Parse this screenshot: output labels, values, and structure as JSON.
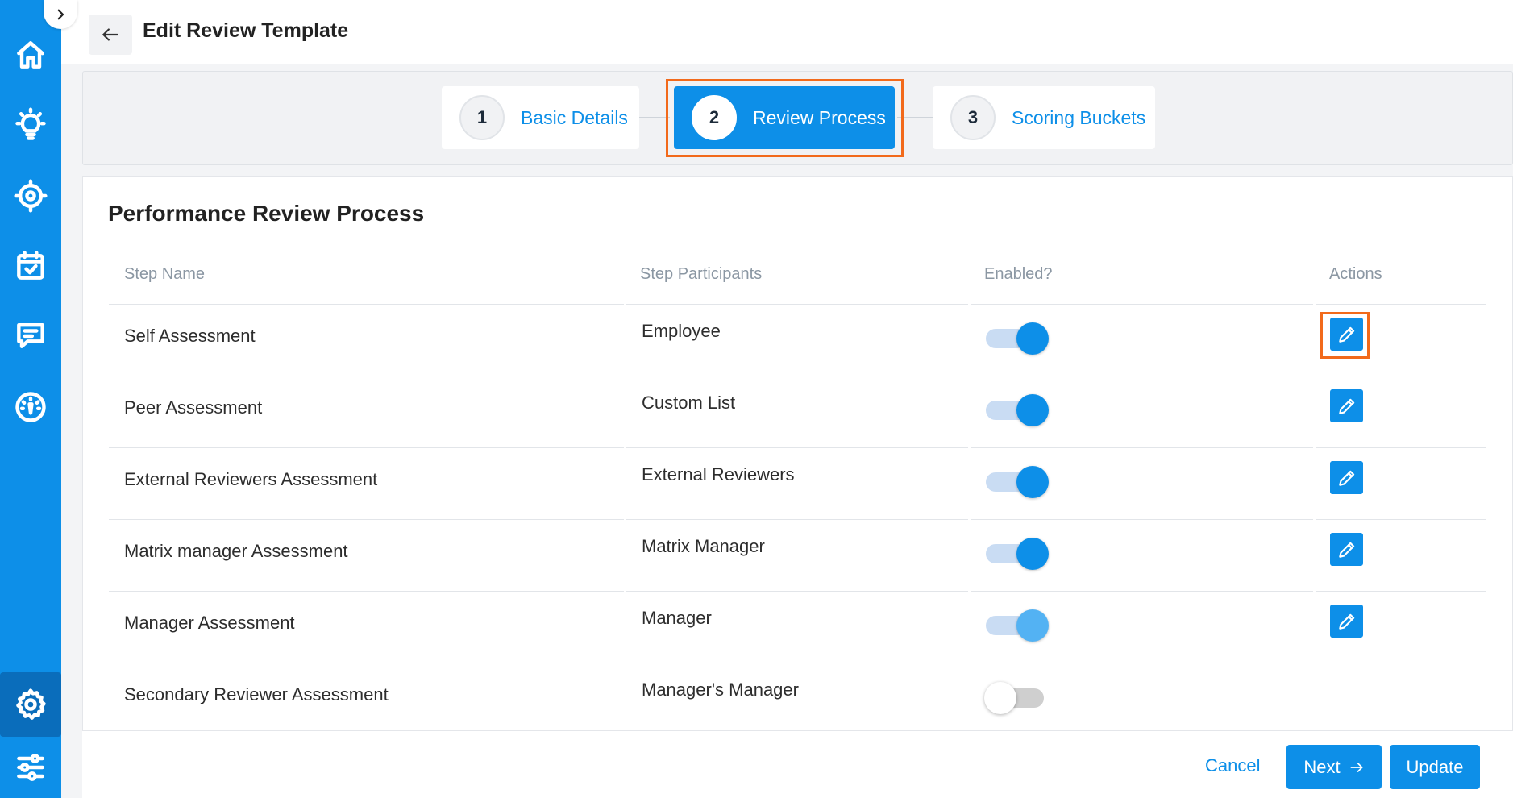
{
  "header": {
    "title": "Edit Review Template",
    "back_icon": "arrow-left-icon"
  },
  "sidebar": {
    "items": [
      {
        "icon": "home-icon"
      },
      {
        "icon": "lightbulb-icon"
      },
      {
        "icon": "target-icon"
      },
      {
        "icon": "calendar-check-icon"
      },
      {
        "icon": "chat-icon"
      },
      {
        "icon": "dashboard-icon"
      },
      {
        "icon": "settings-icon",
        "active": true
      },
      {
        "icon": "sliders-icon"
      }
    ],
    "collapse_icon": "chevron-right-icon"
  },
  "stepper": {
    "steps": [
      {
        "number": "1",
        "label": "Basic Details",
        "active": false
      },
      {
        "number": "2",
        "label": "Review Process",
        "active": true
      },
      {
        "number": "3",
        "label": "Scoring Buckets",
        "active": false
      }
    ]
  },
  "process": {
    "title": "Performance Review Process",
    "columns": [
      "Step Name",
      "Step Participants",
      "Enabled?",
      "Actions"
    ],
    "rows": [
      {
        "name": "Self Assessment",
        "participants": "Employee",
        "enabled": true,
        "editable": true
      },
      {
        "name": "Peer Assessment",
        "participants": "Custom List",
        "enabled": true,
        "editable": true
      },
      {
        "name": "External Reviewers Assessment",
        "participants": "External Reviewers",
        "enabled": true,
        "editable": true
      },
      {
        "name": "Matrix manager Assessment",
        "participants": "Matrix Manager",
        "enabled": true,
        "editable": true
      },
      {
        "name": "Manager Assessment",
        "participants": "Manager",
        "enabled": true,
        "editable": true
      },
      {
        "name": "Secondary Reviewer Assessment",
        "participants": "Manager's Manager",
        "enabled": false,
        "editable": false
      }
    ]
  },
  "footer": {
    "cancel_label": "Cancel",
    "next_label": "Next",
    "update_label": "Update"
  },
  "colors": {
    "primary": "#0d8fe8",
    "highlight": "#f26a1b"
  }
}
